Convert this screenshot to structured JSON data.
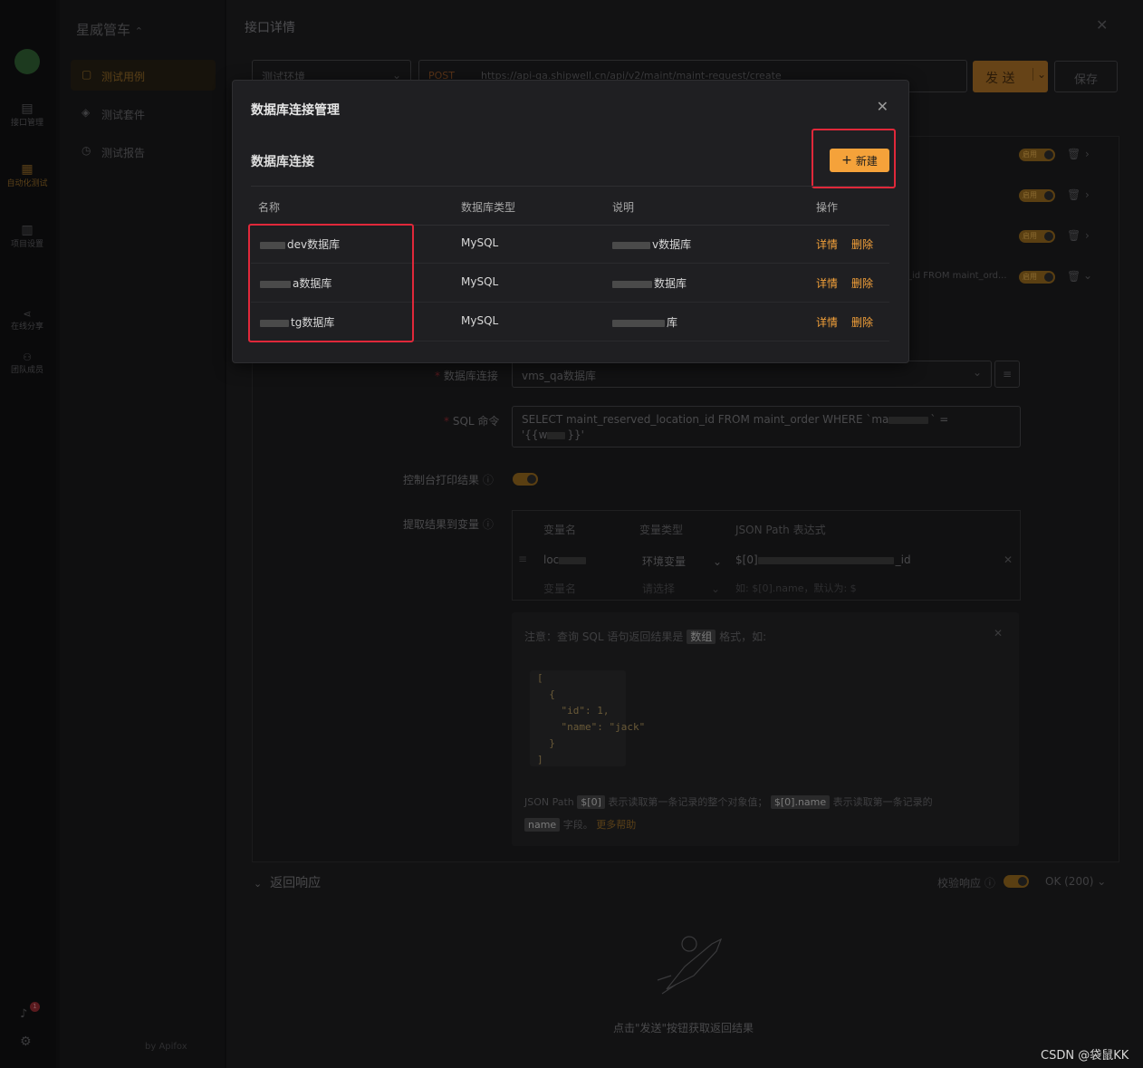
{
  "app": {
    "name": "星威管车",
    "colors": {
      "accent": "#f5a23a",
      "danger": "#e0283a",
      "dialog_bg": "#1f1f22"
    }
  },
  "sidebar_rail": [
    {
      "label": "接口管理",
      "icon": "folder-icon"
    },
    {
      "label": "自动化测试",
      "icon": "automation-icon"
    },
    {
      "label": "项目设置",
      "icon": "settings-icon"
    },
    {
      "label": "在线分享",
      "icon": "share-icon"
    },
    {
      "label": "团队成员",
      "icon": "team-icon"
    }
  ],
  "sidebar_nav": {
    "items": [
      {
        "label": "测试用例",
        "icon": "file-icon"
      },
      {
        "label": "测试套件",
        "icon": "suite-icon"
      },
      {
        "label": "测试报告",
        "icon": "report-icon"
      }
    ],
    "footer": "by Apifox"
  },
  "notification_badge": "1",
  "detail": {
    "title": "接口详情",
    "env": "测试环境",
    "method": "POST",
    "url": "https://api-qa.shipwell.cn/api/v2/maint/maint-request/create",
    "send_label": "发 送",
    "save_label": "保存",
    "step_toggle": "启用",
    "sql_preview": "_id FROM maint_ord...",
    "db_conn_label": "数据库连接",
    "db_conn_value": "vms_qa数据库",
    "sql_label": "SQL 命令",
    "sql_value_line1": "SELECT maint_reserved_location_id FROM maint_order WHERE `ma",
    "sql_value_line1_tail": "` =",
    "sql_value_line2": "'{{w",
    "sql_value_line2_tail": "}}'",
    "console_label": "控制台打印结果",
    "extract_label": "提取结果到变量",
    "var_headers": [
      "变量名",
      "变量类型",
      "JSON Path 表达式"
    ],
    "var_row": {
      "name": "loc",
      "type": "环境变量",
      "path_prefix": "$[0]",
      "path_suffix": "_id"
    },
    "var_new": {
      "name_placeholder": "变量名",
      "type_placeholder": "请选择",
      "path_placeholder": "如: $[0].name，默认为: $"
    },
    "note_prefix": "注意：查询 SQL 语句返回结果是",
    "note_tag": "数组",
    "note_suffix": "格式，如:",
    "code_lines": [
      "[",
      "  {",
      "    \"id\": 1,",
      "    \"name\": \"jack\"",
      "  }",
      "]"
    ],
    "help_line1_a": "JSON Path",
    "help_tag1": "$[0]",
    "help_line1_b": "表示读取第一条记录的整个对象值；",
    "help_tag2": "$[0].name",
    "help_line1_c": "表示读取第一条记录的",
    "help_tag3": "name",
    "help_line2": "字段。",
    "help_link": "更多帮助",
    "response_title": "返回响应",
    "verify_label": "校验响应",
    "status_select": "OK (200)",
    "empty_hint": "点击\"发送\"按钮获取返回结果"
  },
  "modal": {
    "title": "数据库连接管理",
    "section_title": "数据库连接",
    "new_label": "新建",
    "columns": [
      "名称",
      "数据库类型",
      "说明",
      "操作"
    ],
    "rows": [
      {
        "name": "dev数据库",
        "type": "MySQL",
        "desc": "v数据库",
        "detail": "详情",
        "delete": "删除"
      },
      {
        "name": "a数据库",
        "type": "MySQL",
        "desc": "数据库",
        "detail": "详情",
        "delete": "删除"
      },
      {
        "name": "tg数据库",
        "type": "MySQL",
        "desc": "库",
        "detail": "详情",
        "delete": "删除"
      }
    ]
  },
  "watermark": "CSDN @袋鼠KK"
}
